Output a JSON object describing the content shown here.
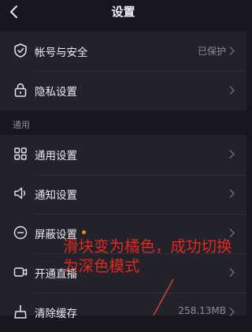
{
  "header": {
    "title": "设置",
    "back_icon": "chevron-left-icon"
  },
  "account_group": {
    "items": [
      {
        "label": "帐号与安全",
        "value": "已保护",
        "icon": "shield-check-icon"
      },
      {
        "label": "隐私设置",
        "value": "",
        "icon": "lock-icon"
      }
    ]
  },
  "general_section": {
    "title": "通用"
  },
  "general_group": {
    "items": [
      {
        "label": "通用设置",
        "value": "",
        "icon": "grid-icon"
      },
      {
        "label": "通知设置",
        "value": "",
        "icon": "speaker-icon"
      },
      {
        "label": "屏蔽设置",
        "value": "",
        "icon": "block-icon"
      },
      {
        "label": "开通直播",
        "value": "",
        "icon": "video-camera-icon"
      },
      {
        "label": "清除缓存",
        "value": "258.13MB",
        "icon": "broom-icon"
      }
    ]
  },
  "annotation": {
    "text": "滑块变为橘色，成功切换为深色模式",
    "color": "#e2281f",
    "dot_color": "#f2811d"
  },
  "colors": {
    "background": "#17171f",
    "card": "#22222a",
    "accent_dot": "#f2811d"
  }
}
